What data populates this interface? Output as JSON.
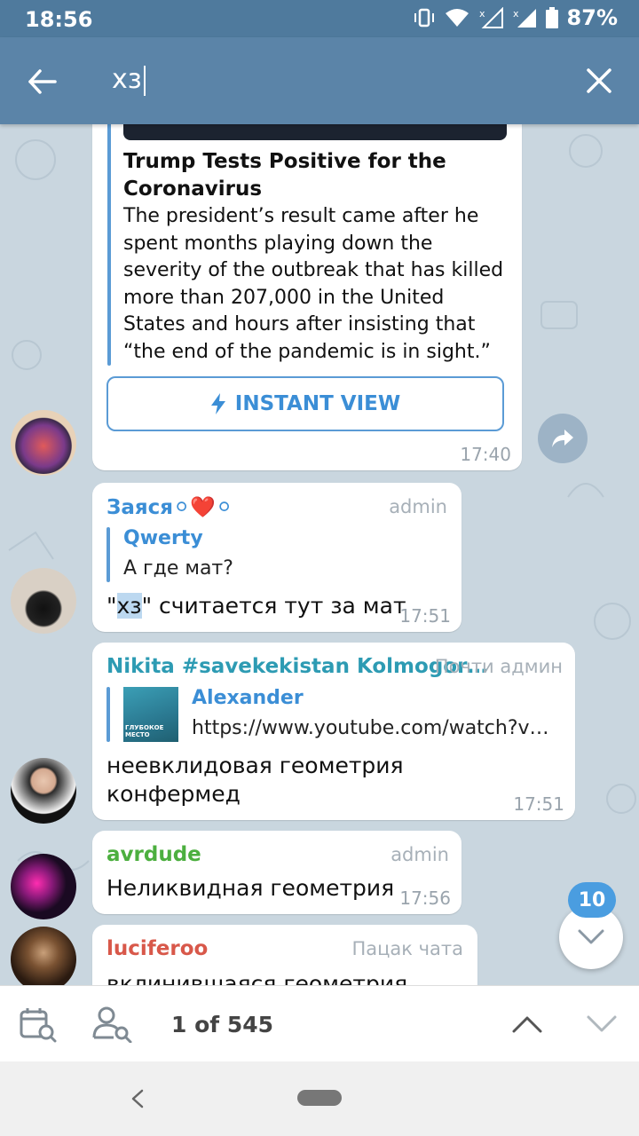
{
  "status": {
    "time": "18:56",
    "battery": "87%"
  },
  "search": {
    "query": "хз"
  },
  "article": {
    "title": "Trump Tests Positive for the Coronavirus",
    "body": "The president’s result came after he spent months playing down the severity of the outbreak that has killed more than 207,000 in the United States and hours after insisting that “the end of the pandemic is in sight.”",
    "instant_view": "INSTANT VIEW",
    "time": "17:40"
  },
  "messages": [
    {
      "sender": "Заяся",
      "emoji": "⚪❤️⚪",
      "role": "admin",
      "reply_name": "Qwerty",
      "reply_text": "А где мат?",
      "text_q1": "\"",
      "text_hl": "хз",
      "text_q2": "\" считается тут за мат",
      "time": "17:51"
    },
    {
      "sender": "Nikita #savekekistan Kolmogor…",
      "role": "Почти админ",
      "reply_name": "Alexander",
      "reply_text": "https://www.youtube.com/watch?v…",
      "thumb_caption": "ГЛУБОКОЕ МЕСТО",
      "text1": "неевклидовая геометрия",
      "text2": "конфермед",
      "time": "17:51"
    },
    {
      "sender": "avrdude",
      "role": "admin",
      "text": "Неликвидная геометрия",
      "time": "17:56"
    },
    {
      "sender": "luciferoo",
      "role": "Пацак чата",
      "text": "вклинившаяся геометрия"
    }
  ],
  "unread_badge": "10",
  "search_nav": {
    "counter": "1 of 545"
  },
  "colors": {
    "accent": "#5b84a8",
    "link": "#3b8ed6"
  }
}
